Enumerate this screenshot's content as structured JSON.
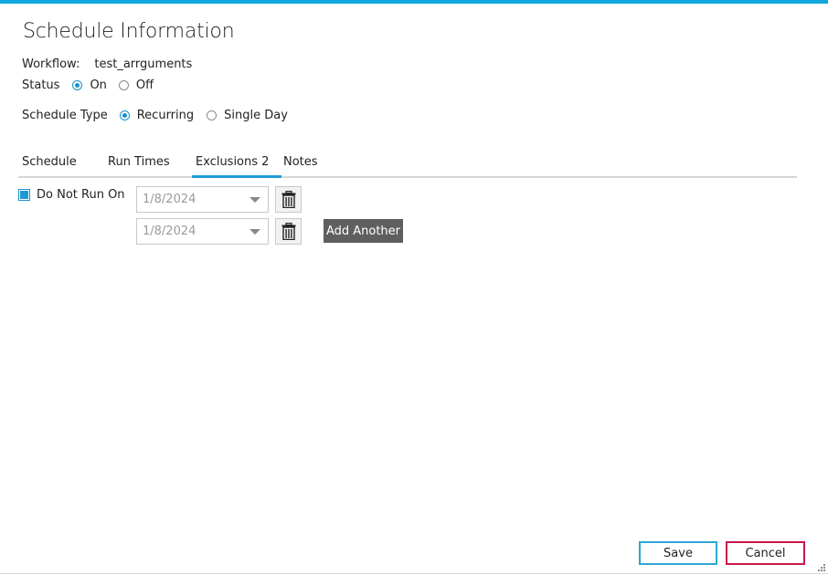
{
  "header": {
    "title": "Schedule Information"
  },
  "workflow": {
    "label": "Workflow:",
    "value": "test_arrguments"
  },
  "status": {
    "label": "Status",
    "options": [
      {
        "label": "On",
        "checked": true
      },
      {
        "label": "Off",
        "checked": false
      }
    ]
  },
  "schedule_type": {
    "label": "Schedule Type",
    "options": [
      {
        "label": "Recurring",
        "checked": true
      },
      {
        "label": "Single Day",
        "checked": false
      }
    ]
  },
  "tabs": [
    {
      "label": "Schedule",
      "active": false
    },
    {
      "label": "Run Times",
      "active": false
    },
    {
      "label": "Exclusions 2",
      "active": true
    },
    {
      "label": "Notes",
      "active": false
    }
  ],
  "exclusions": {
    "checkbox_label": "Do Not Run On",
    "checked": true,
    "dates": [
      "1/8/2024",
      "1/8/2024"
    ],
    "add_label": "Add Another"
  },
  "footer": {
    "save_label": "Save",
    "cancel_label": "Cancel"
  },
  "colors": {
    "accent": "#11a6de",
    "cancel_border": "#c8184a",
    "add_button": "#5f5f5f"
  },
  "icons": {
    "delete": "trash-icon",
    "dropdown": "chevron-down-icon",
    "resize": "resize-grip-icon"
  }
}
